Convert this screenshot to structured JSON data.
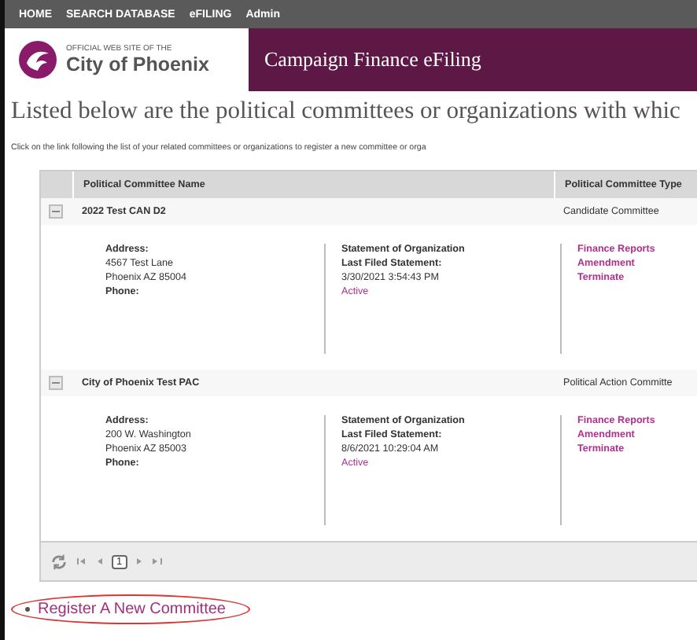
{
  "nav": [
    "HOME",
    "SEARCH DATABASE",
    "eFILING",
    "Admin"
  ],
  "logo": {
    "small": "OFFICIAL WEB SITE OF THE",
    "big": "City of Phoenix"
  },
  "banner": "Campaign Finance eFiling",
  "heading": "Listed below are the political committees or organizations with whic",
  "instruction": "Click on the link following the list of your related committees or organizations to register a new committee or orga",
  "columns": [
    "Political Committee Name",
    "Political Committee Type"
  ],
  "committees": [
    {
      "name": "2022 Test CAN D2",
      "type": "Candidate Committee",
      "expanded": true,
      "address_label": "Address:",
      "address": [
        "4567 Test Lane",
        "Phoenix AZ 85004"
      ],
      "phone_label": "Phone:",
      "statement": "Statement of Organization",
      "last_label": "Last Filed Statement:",
      "last": "3/30/2021 3:54:43 PM",
      "status": "Active",
      "links": [
        "Finance Reports",
        "Amendment",
        "Terminate"
      ]
    },
    {
      "name": "City of Phoenix Test PAC",
      "type": "Political Action Committe",
      "expanded": true,
      "address_label": "Address:",
      "address": [
        "200 W. Washington",
        "Phoenix AZ 85003"
      ],
      "phone_label": "Phone:",
      "statement": "Statement of Organization",
      "last_label": "Last Filed Statement:",
      "last": "8/6/2021 10:29:04 AM",
      "status": "Active",
      "links": [
        "Finance Reports",
        "Amendment",
        "Terminate"
      ]
    }
  ],
  "pager": {
    "page": "1"
  },
  "register_link": "Register A New Committee"
}
